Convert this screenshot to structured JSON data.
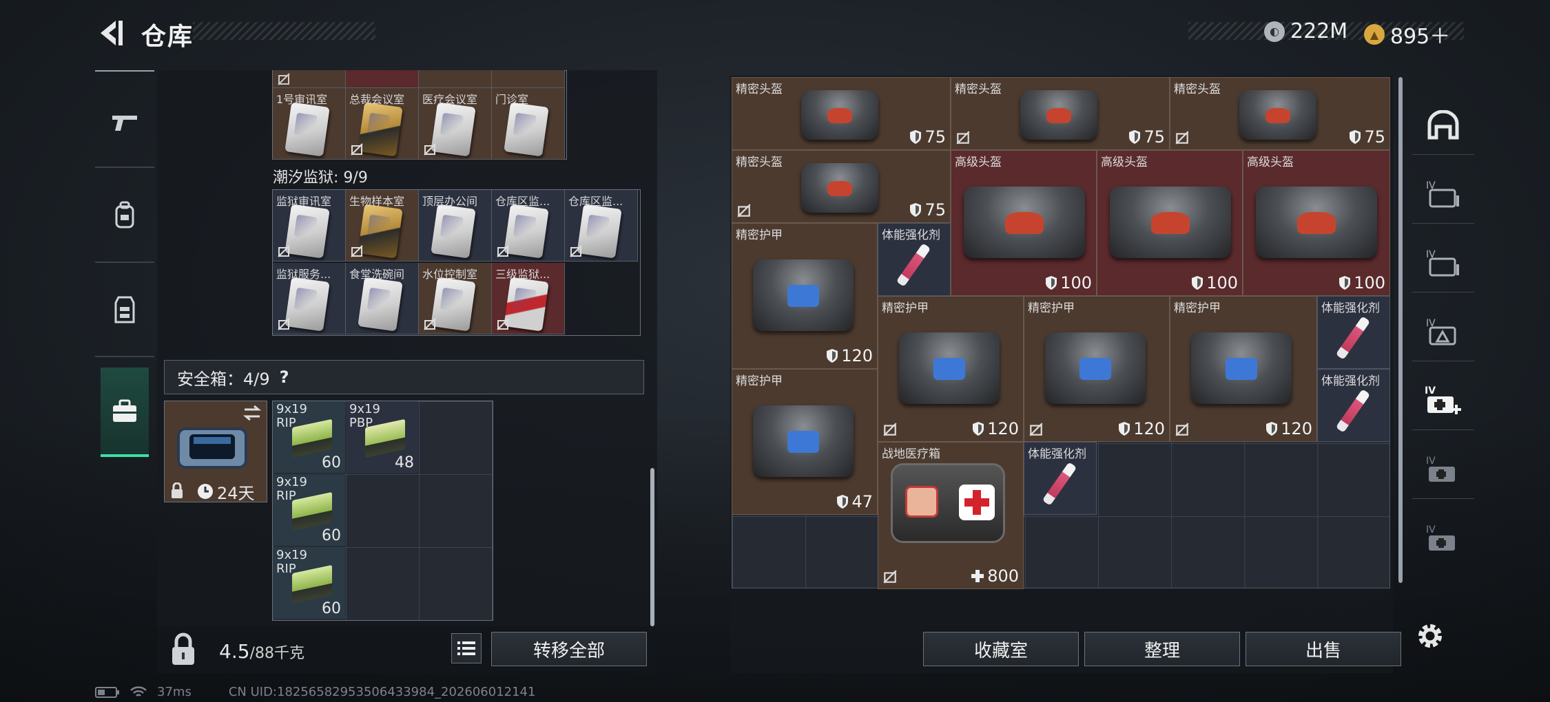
{
  "header": {
    "title": "仓库"
  },
  "currency": [
    {
      "icon": "silver-coin-icon",
      "value": "222M"
    },
    {
      "icon": "gold-coin-icon",
      "value": "895＋"
    }
  ],
  "left_tabs": [
    "gun-icon",
    "backpack-icon",
    "vest-icon",
    "safe-case-icon"
  ],
  "top_partial_grid": {
    "row2": [
      "1号审讯室",
      "总裁会议室",
      "医疗会议室",
      "门诊室"
    ]
  },
  "prison": {
    "label": "潮汐监狱: 9/9",
    "row1": [
      "监狱审讯室",
      "生物样本室",
      "顶层办公间",
      "仓库区监...",
      "仓库区监..."
    ],
    "row2": [
      "监狱服务...",
      "食堂洗碗间",
      "水位控制室",
      "三级监狱..."
    ]
  },
  "safe": {
    "label": "安全箱：4/9",
    "help": "?",
    "days": "24天"
  },
  "ammo": [
    {
      "name": "9x19\nRIP",
      "qty": "60"
    },
    {
      "name": "9x19\nPBP",
      "qty": "48"
    },
    {
      "name": "9x19\nRIP",
      "qty": "60"
    },
    {
      "name": "9x19\nRIP",
      "qty": "60"
    }
  ],
  "weight": {
    "value": "4.5",
    "max": "/88千克"
  },
  "buttons": {
    "transfer_all": "转移全部",
    "collection": "收藏室",
    "organize": "整理",
    "sell": "出售"
  },
  "items": {
    "precise_helmet": "精密头盔",
    "advanced_helmet": "高级头盔",
    "precise_armor": "精密护甲",
    "stim": "体能强化剂",
    "medkit": "战地医疗箱",
    "v75": "75",
    "v100": "100",
    "v120": "120",
    "v47": "47",
    "v800": "800"
  },
  "right_tabs": [
    "helmet-slot-icon",
    "container-iv-icon",
    "container-iv-icon",
    "container-iv-triangle-icon",
    "container-iv-medical-add-icon",
    "container-iv-medical-icon",
    "container-iv-medical-icon"
  ],
  "footer": {
    "ping": "37ms",
    "uid": "CN UID:1825658295350643398​4_202606012141"
  },
  "colors": {
    "accent": "#3de0a6",
    "brown_cell": "#4c3a2f",
    "red_cell": "#5a2a2c",
    "blue_cell": "#2c3140"
  }
}
